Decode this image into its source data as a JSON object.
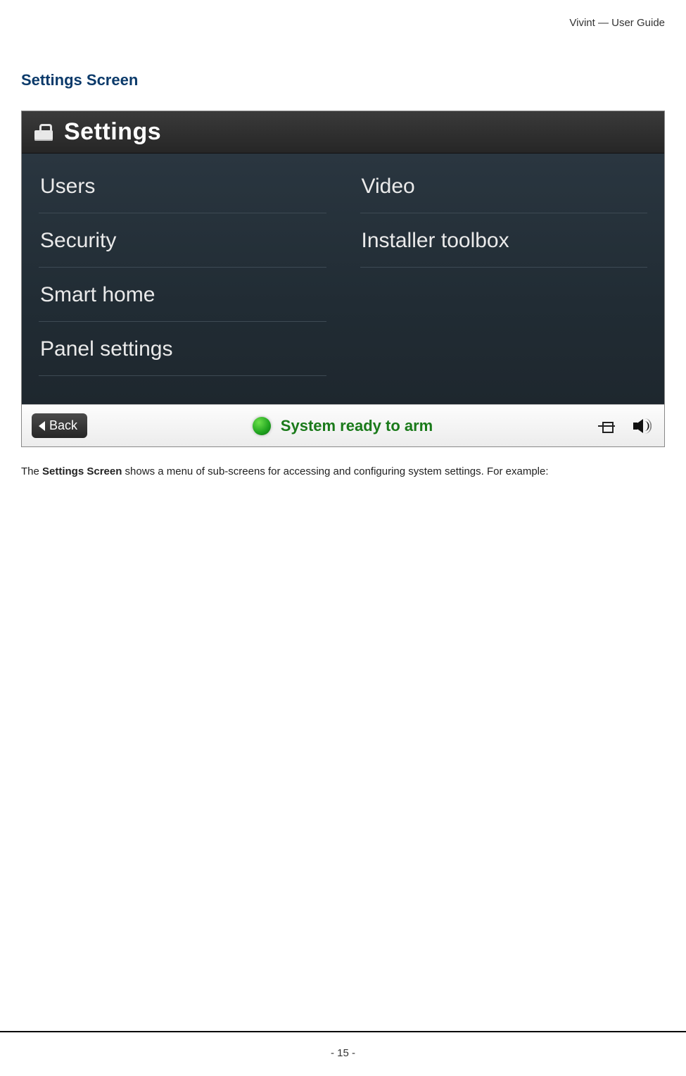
{
  "doc": {
    "running_header": "Vivint — User Guide",
    "section_heading": "Settings Screen",
    "caption_prefix": "The ",
    "caption_strong": "Settings Screen",
    "caption_suffix": " shows a menu of sub-screens for accessing and configuring system settings. For example:",
    "page_number": "- 15 -"
  },
  "panel": {
    "title": "Settings",
    "menu_left": [
      "Users",
      "Security",
      "Smart home",
      "Panel settings"
    ],
    "menu_right": [
      "Video",
      "Installer toolbox"
    ],
    "footer": {
      "back_label": "Back",
      "status_text": "System ready to arm"
    }
  }
}
